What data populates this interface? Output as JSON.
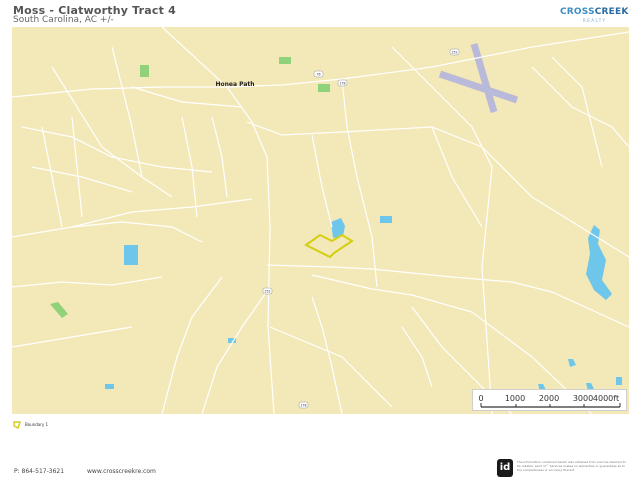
{
  "header": {
    "title": "Moss - Clatworthy  Tract 4",
    "subtitle": "South Carolina,  AC +/-"
  },
  "logo": {
    "cross": "CROSS",
    "creek": "CREEK",
    "realty": "REALTY"
  },
  "map": {
    "colors": {
      "land": "#f3e8b7",
      "water": "#6ec6ea",
      "park": "#8fd27a",
      "road": "#ffffff",
      "runway": "#b9b9d9",
      "boundary": "#d3cf10"
    },
    "place_label": "Honea Path",
    "highway_shields": [
      "252",
      "76",
      "178",
      "252",
      "178"
    ],
    "scale": {
      "labels": [
        "0",
        "1000",
        "2000",
        "3000",
        "4000ft"
      ]
    }
  },
  "legend": {
    "label": "Boundary 1"
  },
  "footer": {
    "phone": "P: 864-517-3621",
    "website": "www.crosscreekre.com",
    "id_badge": "id",
    "disclaimer": "The information contained herein was obtained from sources deemed to be reliable. Land id™ Services makes no warranties or guarantees as to the completeness or accuracy thereof."
  }
}
